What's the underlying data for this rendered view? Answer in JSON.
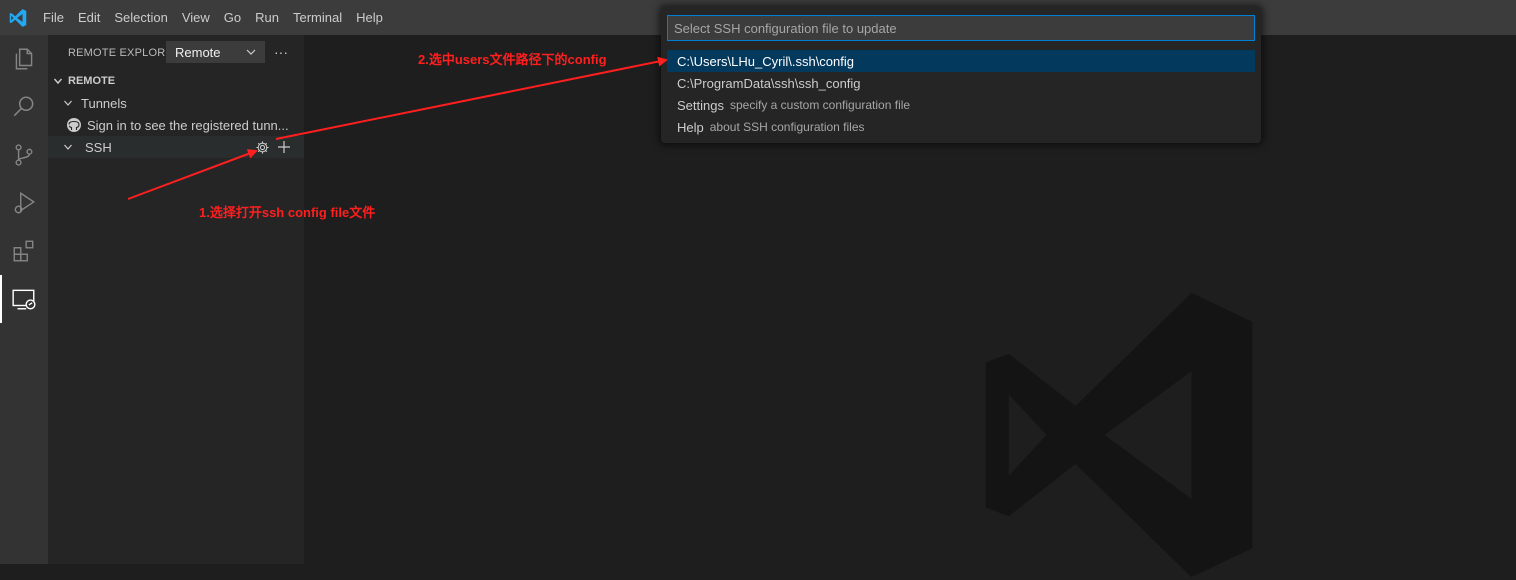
{
  "menu": [
    "File",
    "Edit",
    "Selection",
    "View",
    "Go",
    "Run",
    "Terminal",
    "Help"
  ],
  "activity_bar": {
    "items": [
      {
        "name": "explorer",
        "icon": "files-icon"
      },
      {
        "name": "search",
        "icon": "search-icon"
      },
      {
        "name": "source-control",
        "icon": "source-control-icon"
      },
      {
        "name": "run-debug",
        "icon": "run-debug-icon"
      },
      {
        "name": "extensions",
        "icon": "extensions-icon"
      },
      {
        "name": "remote-explorer",
        "icon": "remote-explorer-icon",
        "active": true
      }
    ]
  },
  "sidebar": {
    "title": "REMOTE EXPLOR...",
    "select_value": "Remote",
    "more_label": "···",
    "section": "REMOTE",
    "tree": {
      "tunnels": "Tunnels",
      "sign_in": "Sign in to see the registered tunn...",
      "ssh": "SSH"
    }
  },
  "quick_pick": {
    "placeholder": "Select SSH configuration file to update",
    "items": [
      {
        "label": "C:\\Users\\LHu_Cyril\\.ssh\\config",
        "description": "",
        "selected": true
      },
      {
        "label": "C:\\ProgramData\\ssh\\ssh_config",
        "description": ""
      },
      {
        "label": "Settings",
        "description": "specify a custom configuration file"
      },
      {
        "label": "Help",
        "description": "about SSH configuration files"
      }
    ]
  },
  "annotations": {
    "step1": "1.选择打开ssh config file文件",
    "step2": "2.选中users文件路径下的config",
    "color": "#ff1f1f"
  },
  "colors": {
    "titlebar": "#3c3c3c",
    "activitybar": "#333333",
    "sidebar": "#252526",
    "editor": "#1e1e1e",
    "accent": "#007fd4",
    "selection": "#04395e",
    "vscode_blue": "#23a9f2"
  }
}
